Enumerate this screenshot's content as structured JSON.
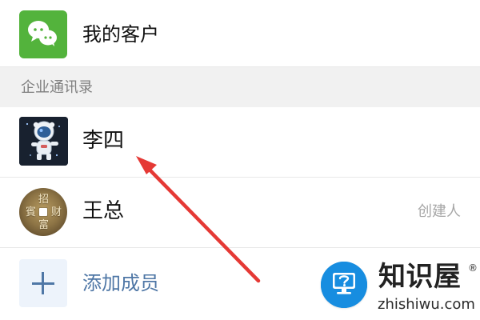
{
  "list": {
    "customers_label": "我的客户",
    "section_label": "企业通讯录",
    "contacts": [
      {
        "name": "李四",
        "avatar": "astronaut-avatar"
      },
      {
        "name": "王总",
        "avatar": "coin-avatar",
        "tag": "创建人",
        "coin_text": [
          "招",
          "賓",
          "财",
          "富"
        ]
      }
    ],
    "add_label": "添加成员"
  },
  "icons": {
    "customers": "wechat-chat-icon",
    "add": "plus-icon",
    "arrow": "arrow-icon",
    "watermark_logo": "question-monitor-icon"
  },
  "annotation": {
    "arrow_color": "#e53935"
  },
  "watermark": {
    "name": "知识屋",
    "domain": "zhishiwu.com",
    "mark": "®"
  },
  "colors": {
    "wechat_green": "#53b33c",
    "section_bg": "#f1f1f1",
    "link_blue": "#4f77a6",
    "muted_text": "#a6a6a6",
    "watermark_blue": "#178de0"
  }
}
